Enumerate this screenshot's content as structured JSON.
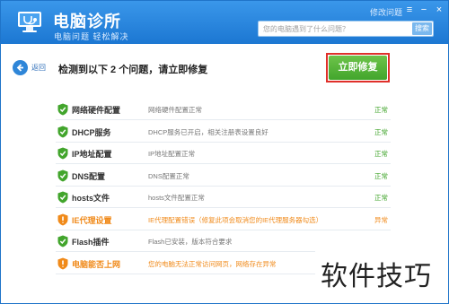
{
  "app": {
    "title": "电脑诊所",
    "subtitle": "电脑问题 轻松解决",
    "header_link": "修改问题"
  },
  "search": {
    "placeholder": "您的电脑遇到了什么问题？",
    "button_label": "搜索"
  },
  "nav": {
    "back_label": "返回"
  },
  "summary": {
    "headline": "检测到以下 2 个问题，请立即修复",
    "fix_button": "立即修复"
  },
  "colors": {
    "header_blue": "#1c77d2",
    "ok_green": "#42a52c",
    "warn_orange": "#f08a1a",
    "highlight_red": "#e0302a"
  },
  "results": [
    {
      "name": "网络硬件配置",
      "detail": "网络硬件配置正常",
      "status": "正常",
      "state": "ok"
    },
    {
      "name": "DHCP服务",
      "detail": "DHCP服务已开启，相关注册表设置良好",
      "status": "正常",
      "state": "ok"
    },
    {
      "name": "IP地址配置",
      "detail": "IP地址配置正常",
      "status": "正常",
      "state": "ok"
    },
    {
      "name": "DNS配置",
      "detail": "DNS配置正常",
      "status": "正常",
      "state": "ok"
    },
    {
      "name": "hosts文件",
      "detail": "hosts文件配置正常",
      "status": "正常",
      "state": "ok"
    },
    {
      "name": "IE代理设置",
      "detail": "IE代理配置错误（修复此项会取消您的IE代理服务器勾选）",
      "status": "异常",
      "state": "warn"
    },
    {
      "name": "Flash插件",
      "detail": "Flash已安装，版本符合要求",
      "status": "",
      "state": "ok"
    },
    {
      "name": "电脑能否上网",
      "detail": "您的电脑无法正常访问网页，网络存在异常",
      "status": "",
      "state": "warn"
    }
  ],
  "watermark": "软件技巧"
}
